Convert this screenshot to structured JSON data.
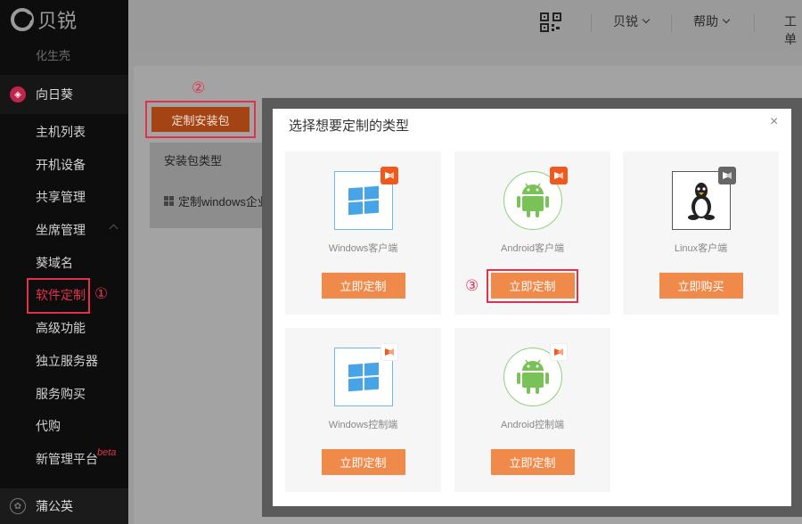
{
  "sidebar": {
    "logo_text": "贝锐",
    "top_partial": "化生壳",
    "section_sunflower": "向日葵",
    "items": [
      {
        "label": "主机列表"
      },
      {
        "label": "开机设备"
      },
      {
        "label": "共享管理"
      },
      {
        "label": "坐席管理"
      },
      {
        "label": "葵域名"
      },
      {
        "label": "软件定制"
      },
      {
        "label": "高级功能"
      },
      {
        "label": "独立服务器"
      },
      {
        "label": "服务购买"
      },
      {
        "label": "代购"
      },
      {
        "label": "新管理平台"
      }
    ],
    "beta": "beta",
    "section_dandelion": "蒲公英"
  },
  "header": {
    "brand_menu": "贝锐",
    "help_menu": "帮助",
    "ticket_partial": "工单"
  },
  "main": {
    "custom_button": "定制安装包",
    "table_head": "安装包类型",
    "table_row": "定制windows企业版"
  },
  "annotations": {
    "step1": "①",
    "step2": "②",
    "step3": "③"
  },
  "modal": {
    "title": "选择想要定制的类型",
    "close": "×",
    "cards": [
      {
        "label": "Windows客户端",
        "button": "立即定制",
        "icon": "windows-icon"
      },
      {
        "label": "Android客户端",
        "button": "立即定制",
        "icon": "android-icon"
      },
      {
        "label": "Linux客户端",
        "button": "立即购买",
        "icon": "linux-icon"
      },
      {
        "label": "Windows控制端",
        "button": "立即定制",
        "icon": "windows-icon"
      },
      {
        "label": "Android控制端",
        "button": "立即定制",
        "icon": "android-icon"
      }
    ]
  },
  "colors": {
    "accent_red": "#e3314b",
    "button_orange": "#f08a4b",
    "windows_blue": "#47a4e6",
    "android_green": "#79c257"
  }
}
